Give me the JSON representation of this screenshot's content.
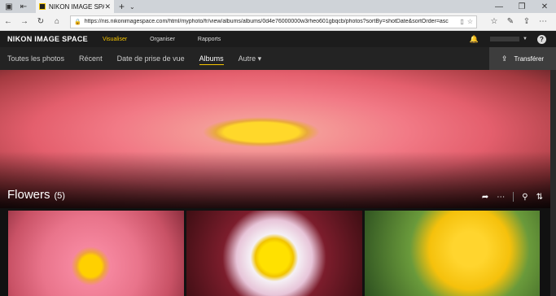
{
  "browser": {
    "tab_title": "NIKON IMAGE SPACE",
    "url": "https://nis.nikonimagespace.com/html/myphoto/fr/view/albums/albums/0d4e76000000w3rheo601gbqcb/photos?sortBy=shotDate&sortOrder=asc"
  },
  "app": {
    "brand": "NIKON IMAGE SPACE",
    "topnav": [
      "Visualiser",
      "Organiser",
      "Rapports"
    ],
    "subnav": [
      "Toutes les photos",
      "Récent",
      "Date de prise de vue",
      "Albums",
      "Autre ▾"
    ],
    "upload_label": "Transférer",
    "help_label": "?"
  },
  "album": {
    "title": "Flowers",
    "count": "(5)"
  },
  "colors": {
    "accent": "#f5c400",
    "header_bg": "#1c1c1c",
    "subnav_bg": "#232323"
  }
}
